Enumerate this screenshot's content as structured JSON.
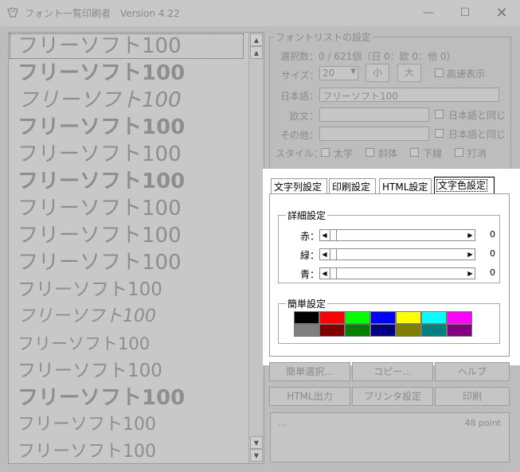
{
  "window": {
    "title": "フォント一覧印刷者　Version 4.22",
    "min_glyph": "—",
    "max_glyph": "☐",
    "close_glyph": "✕"
  },
  "fontlist": {
    "rows": [
      "フリーソフト100",
      "フリーソフト100",
      "フリーソフト100",
      "フリーソフト100",
      "フリーソフト100",
      "フリーソフト100",
      "フリーソフト100",
      "フリーソフト100",
      "フリーソフト100",
      "フリーソフト100",
      "フリーソフト100",
      "フリーソフト100",
      "フリーソフト100",
      "フリーソフト100",
      "フリーソフト100",
      "フリーソフト100"
    ]
  },
  "settings": {
    "group_title": "フォントリストの設定",
    "count_label": "選択数：0 / 621個（日 0：欧 0：他 0）",
    "size_label": "サイズ：",
    "size_value": "20",
    "small_button": "小",
    "large_button": "大",
    "fast_display": "高速表示",
    "japanese_label": "日本語：",
    "japanese_value": "フリーソフト100",
    "western_label": "欧文：",
    "western_value": "",
    "same_as_japanese": "日本語と同じ",
    "other_label": "その他：",
    "other_value": "",
    "style_label": "スタイル：",
    "bold": "太字",
    "italic": "斜体",
    "underline": "下線",
    "strike": "打消"
  },
  "tabs": [
    "文字列設定",
    "印刷設定",
    "HTML設定",
    "文字色設定"
  ],
  "color_tab": {
    "detail_title": "詳細設定",
    "red_label": "赤：",
    "green_label": "緑：",
    "blue_label": "青：",
    "red_value": "0",
    "green_value": "0",
    "blue_value": "0",
    "simple_title": "簡単設定",
    "palette": [
      "#000000",
      "#ff0000",
      "#00ff00",
      "#0000ff",
      "#ffff00",
      "#00ffff",
      "#ff00ff",
      "#808080",
      "#800000",
      "#008000",
      "#000080",
      "#808000",
      "#008080",
      "#800080"
    ]
  },
  "actions": {
    "simple_select": "簡単選択...",
    "copy": "コピー...",
    "help": "ヘルプ",
    "html_output": "HTML出力",
    "printer_settings": "プリンタ設定",
    "print": "印刷"
  },
  "preview": {
    "text": "...",
    "point_label": "48 point"
  }
}
